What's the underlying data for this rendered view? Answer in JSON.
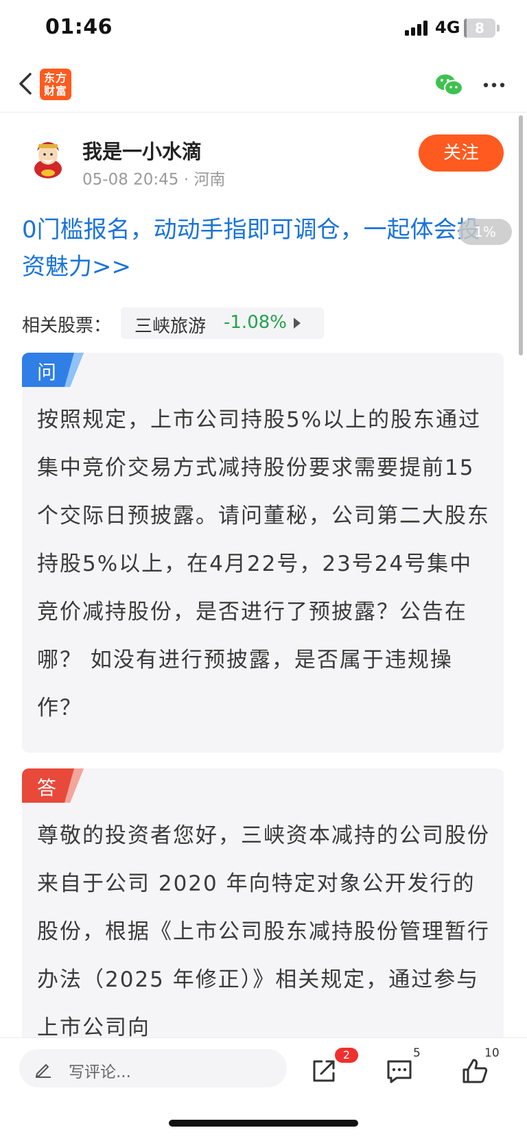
{
  "status_bar": {
    "time": "01:46",
    "network": "4G",
    "battery": "8",
    "battery_level_percent": 8
  },
  "nav": {
    "back_icon": "chevron-left-icon",
    "logo_line1": "东方",
    "logo_line2": "财富",
    "share_wechat_icon": "wechat-icon",
    "more_icon": "more-dots-icon",
    "brand_color": "#ff5a1f"
  },
  "author": {
    "name": "我是一小水滴",
    "meta": "05-08 20:45 · 河南",
    "follow_label": "关注"
  },
  "promo": {
    "text": "0门槛报名，动动手指即可调仓，一起体会投资魅力>>",
    "link_color": "#1a73d9"
  },
  "float_pill": "1%",
  "related": {
    "label": "相关股票：",
    "stock_name": "三峡旅游",
    "stock_change": "-1.08%",
    "change_color": "#22a34b"
  },
  "question": {
    "badge": "问",
    "badge_color": "#2f7fe6",
    "text": "按照规定，上市公司持股5%以上的股东通过集中竞价交易方式减持股份要求需要提前15个交际日预披露。请问董秘，公司第二大股东持股5%以上，在4月22号，23号24号集中竞价减持股份，是否进行了预披露？公告在哪？ 如没有进行预披露，是否属于违规操作？"
  },
  "answer": {
    "badge": "答",
    "badge_color": "#e8493a",
    "text": "尊敬的投资者您好，三峡资本减持的公司股份来自于公司 2020 年向特定对象公开发行的股份，根据《上市公司股东减持股份管理暂行办法（2025 年修正）》相关规定，通过参与上市公司向"
  },
  "bottom_bar": {
    "comment_placeholder": "写评论...",
    "share_badge": "2",
    "comment_count": "5",
    "like_count": "10"
  }
}
